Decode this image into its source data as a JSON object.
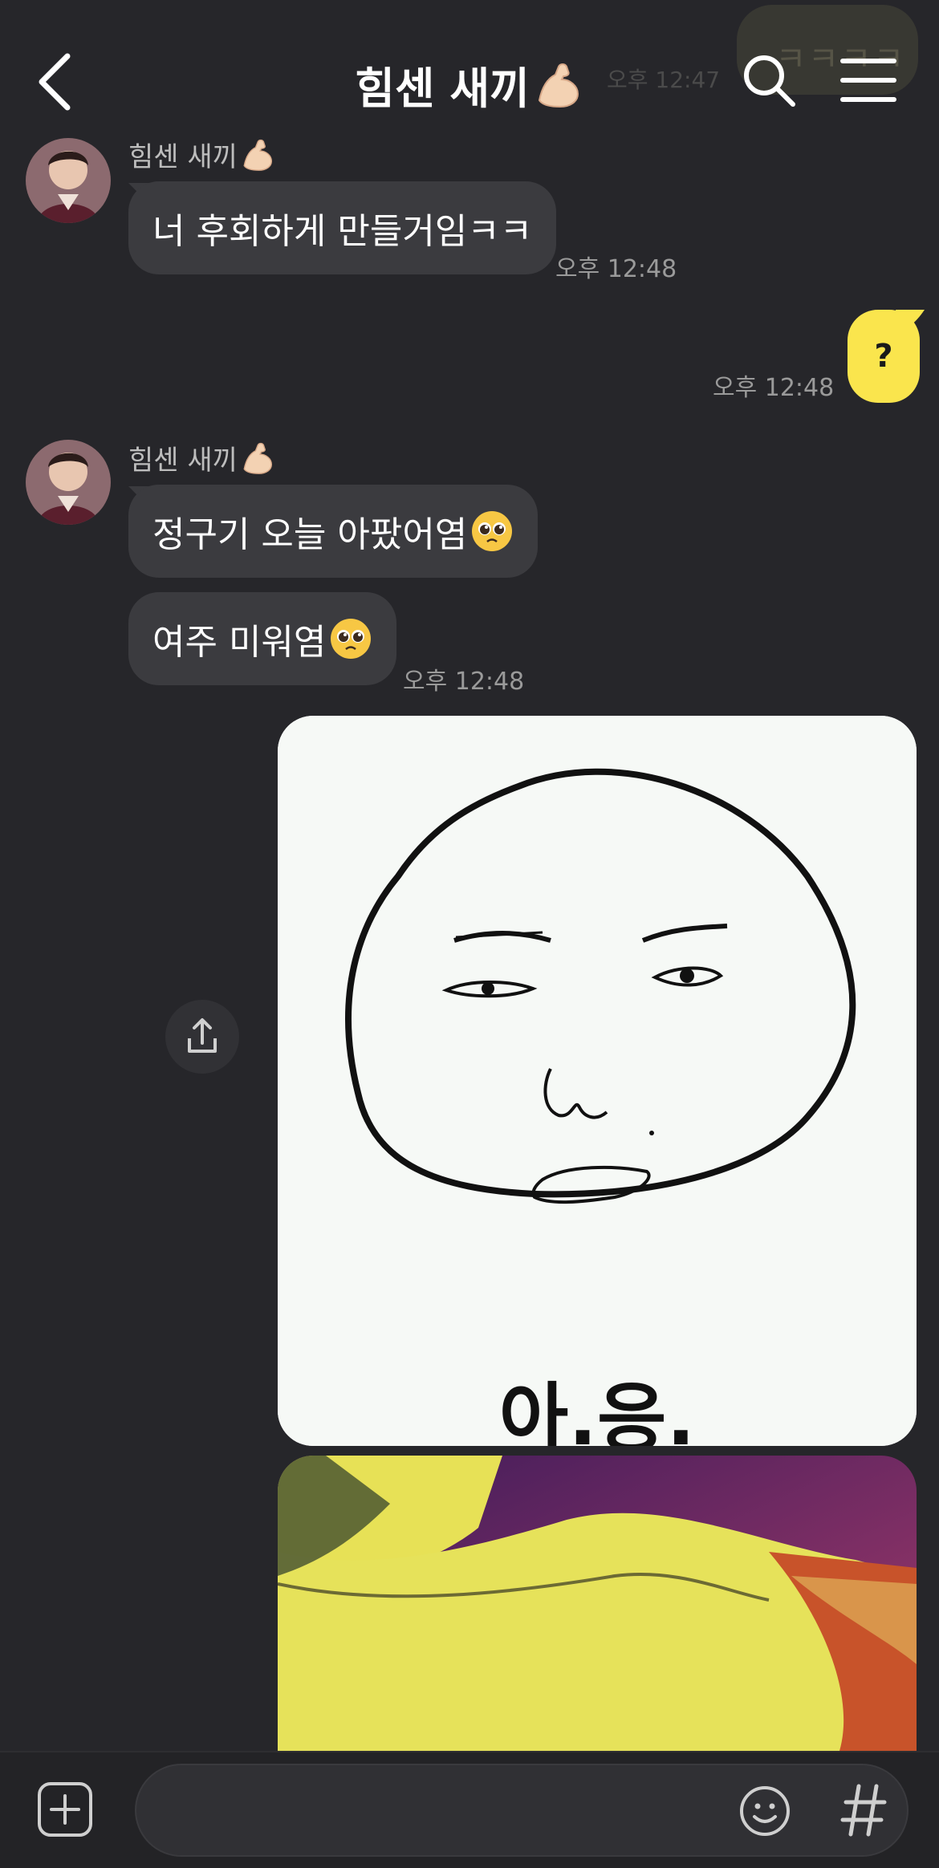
{
  "header": {
    "title": "힘센 새끼",
    "title_emoji_icon": "flexed-biceps-icon"
  },
  "ghost": {
    "text": "ㅋㅋㅋㅋ",
    "time": "오후 12:47"
  },
  "messages": [
    {
      "sender": "힘센 새끼",
      "text": "너 후회하게 만들거임ㅋㅋ",
      "time": "오후 12:48"
    },
    {
      "outgoing_text": "?",
      "time": "오후 12:48"
    },
    {
      "sender": "힘센 새끼",
      "text": "정구기 오늘 아팠어염",
      "emoji": "pleading-face-icon"
    },
    {
      "text": "여주 미워염",
      "emoji": "pleading-face-icon",
      "time": "오후 12:48"
    }
  ],
  "image1": {
    "caption": "아.응."
  },
  "colors": {
    "background": "#26262a",
    "incoming_bubble": "#3b3b3f",
    "outgoing_bubble": "#fae54d"
  }
}
